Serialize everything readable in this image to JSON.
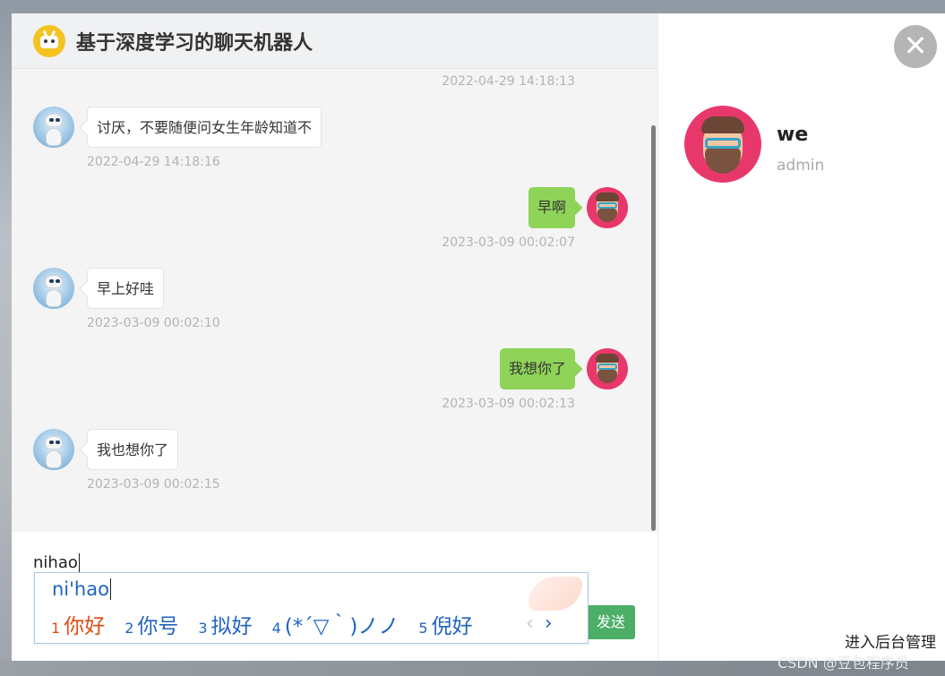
{
  "chat": {
    "title": "基于深度学习的聊天机器人",
    "messages": [
      {
        "from": "bot",
        "text": "讨厌，不要随便问女生年龄知道不",
        "time": "2022-04-29 14:18:16"
      },
      {
        "from": "user",
        "text": "早啊",
        "time": "2023-03-09 00:02:07"
      },
      {
        "from": "bot",
        "text": "早上好哇",
        "time": "2023-03-09 00:02:10"
      },
      {
        "from": "user",
        "text": "我想你了",
        "time": "2023-03-09 00:02:13"
      },
      {
        "from": "bot",
        "text": "我也想你了",
        "time": "2023-03-09 00:02:15"
      }
    ],
    "previous_timestamp": "2022-04-29 14:18:13"
  },
  "input": {
    "value": "nihao",
    "send_label": "发送"
  },
  "ime": {
    "composition": "ni'hao",
    "candidates": [
      {
        "num": "1",
        "text": "你好"
      },
      {
        "num": "2",
        "text": "你号"
      },
      {
        "num": "3",
        "text": "拟好"
      },
      {
        "num": "4",
        "text": "(*´▽｀)ノノ"
      },
      {
        "num": "5",
        "text": "倪好"
      }
    ],
    "prev_symbol": "‹",
    "next_symbol": "›"
  },
  "profile": {
    "name": "we",
    "role": "admin",
    "close_symbol": "✕",
    "admin_link": "进入后台管理"
  },
  "watermark": "CSDN @豆包程序员",
  "colors": {
    "user_bubble": "#8fd458",
    "send_button": "#4cae67",
    "close_button": "#b5b5b5",
    "logo": "#f5c321"
  },
  "icons": [
    "robot-logo-icon",
    "bot-avatar-icon",
    "user-avatar-icon",
    "close-icon"
  ]
}
